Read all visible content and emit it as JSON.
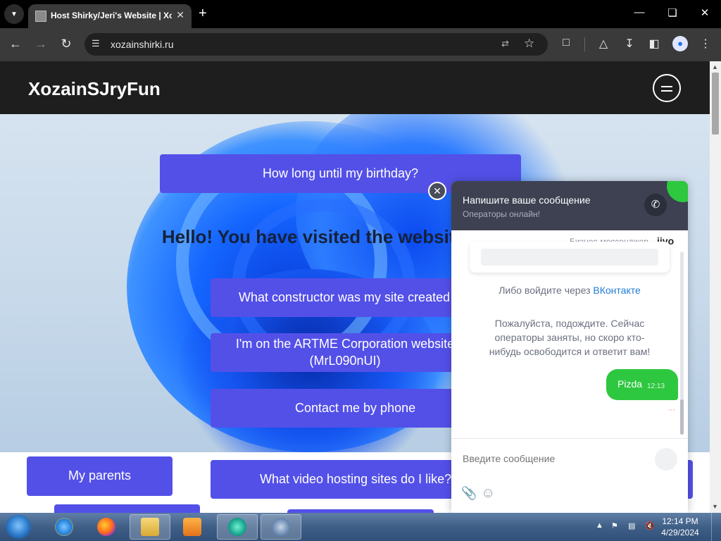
{
  "browser": {
    "tab_title": "Host Shirky/Jeri's Website | Xo",
    "url": "xozainshirki.ru",
    "icons": [
      "tab-search-icon",
      "close-icon",
      "plus-icon",
      "minimize-icon",
      "restore-icon",
      "close-window-icon",
      "back-icon",
      "forward-icon",
      "reload-icon",
      "site-info-icon",
      "translate-icon",
      "star-icon",
      "extensions-icon",
      "labs-icon",
      "download-icon",
      "sidebar-icon",
      "profile-icon",
      "menu-icon"
    ]
  },
  "site": {
    "logo": "XozainSJryFun",
    "hero_title": "Hello! You have visited the website of Shirky/Jeri.",
    "buttons": {
      "birthday": "How long until my birthday?",
      "constructor": "What constructor was my site created on?",
      "artme": "I'm on the ARTME Corporation website (MrL090nUI)",
      "contact": "Contact me by phone",
      "parents": "My parents",
      "video": "What video hosting sites do I like?"
    }
  },
  "chat": {
    "header_title": "Напишите ваше сообщение",
    "header_status": "Операторы онлайн!",
    "brand_text": "Бизнес-мессенджер",
    "brand_logo": "jivo",
    "login_prefix": "Либо войдите через",
    "login_link": "ВКонтакте",
    "wait_text": "Пожалуйста, подождите. Сейчас операторы заняты, но скоро кто-нибудь освободится и ответит вам!",
    "message_text": "Pizda",
    "message_time": "12:13",
    "input_placeholder": "Введите сообщение"
  },
  "taskbar": {
    "time": "12:14 PM",
    "date": "4/29/2024",
    "apps": [
      "internet-explorer",
      "firefox",
      "file-explorer",
      "media-player",
      "browser-active",
      "app-window"
    ]
  },
  "colors": {
    "button_purple": "#5350e8",
    "chat_header": "#3d4152",
    "chat_green": "#2dc83f",
    "link_blue": "#1e7bd6"
  }
}
